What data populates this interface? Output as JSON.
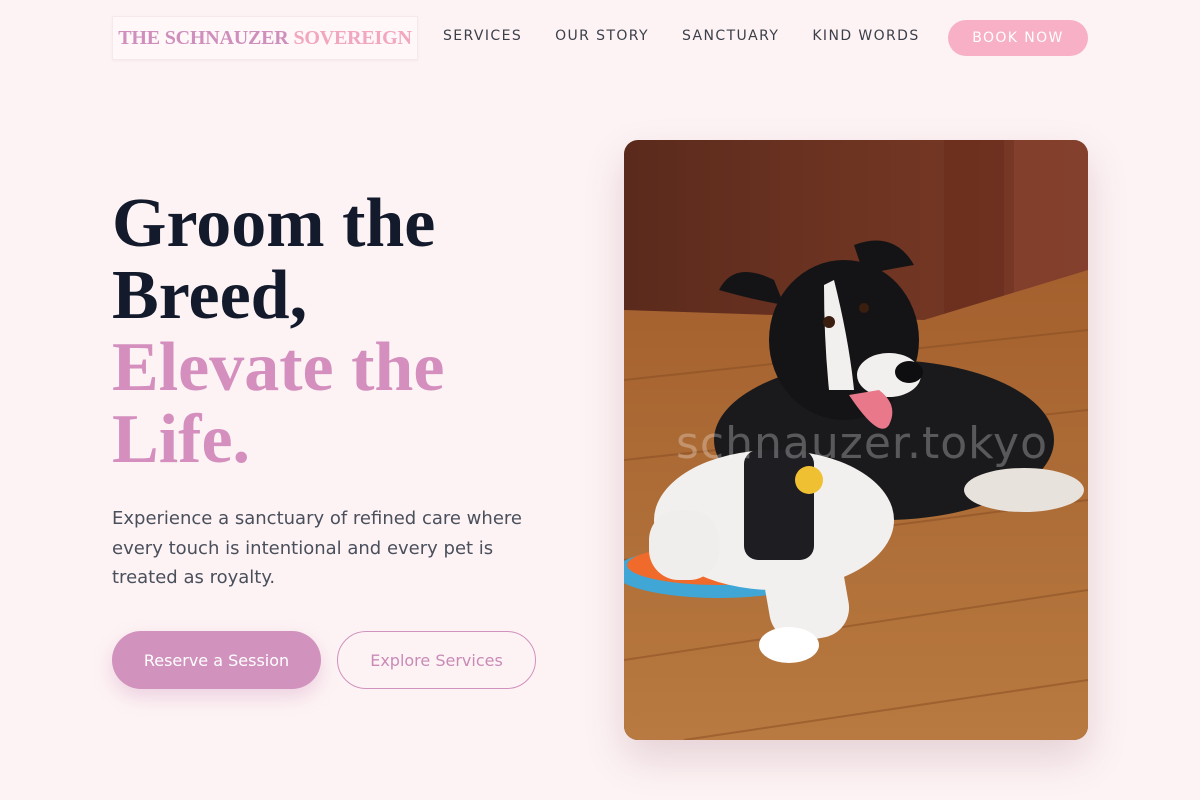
{
  "brand": {
    "name_part1": "THE SCHNAUZER",
    "name_part2": "SOVEREIGN"
  },
  "nav": {
    "items": [
      {
        "label": "SERVICES"
      },
      {
        "label": "OUR STORY"
      },
      {
        "label": "SANCTUARY"
      },
      {
        "label": "KIND WORDS"
      }
    ],
    "cta_label": "BOOK NOW"
  },
  "hero": {
    "title_line1": "Groom the",
    "title_line2": "Breed,",
    "title_accent_line1": "Elevate the",
    "title_accent_line2": "Life.",
    "subtitle": "Experience a sanctuary of refined care where every touch is intentional and every pet is treated as royalty.",
    "primary_button": "Reserve a Session",
    "secondary_button": "Explore Services"
  },
  "photo": {
    "watermark": "schnauzer.tokyo"
  },
  "colors": {
    "background": "#fdf3f4",
    "accent": "#d192bd",
    "accent_light": "#f7b0c6",
    "heading": "#131a2c"
  }
}
